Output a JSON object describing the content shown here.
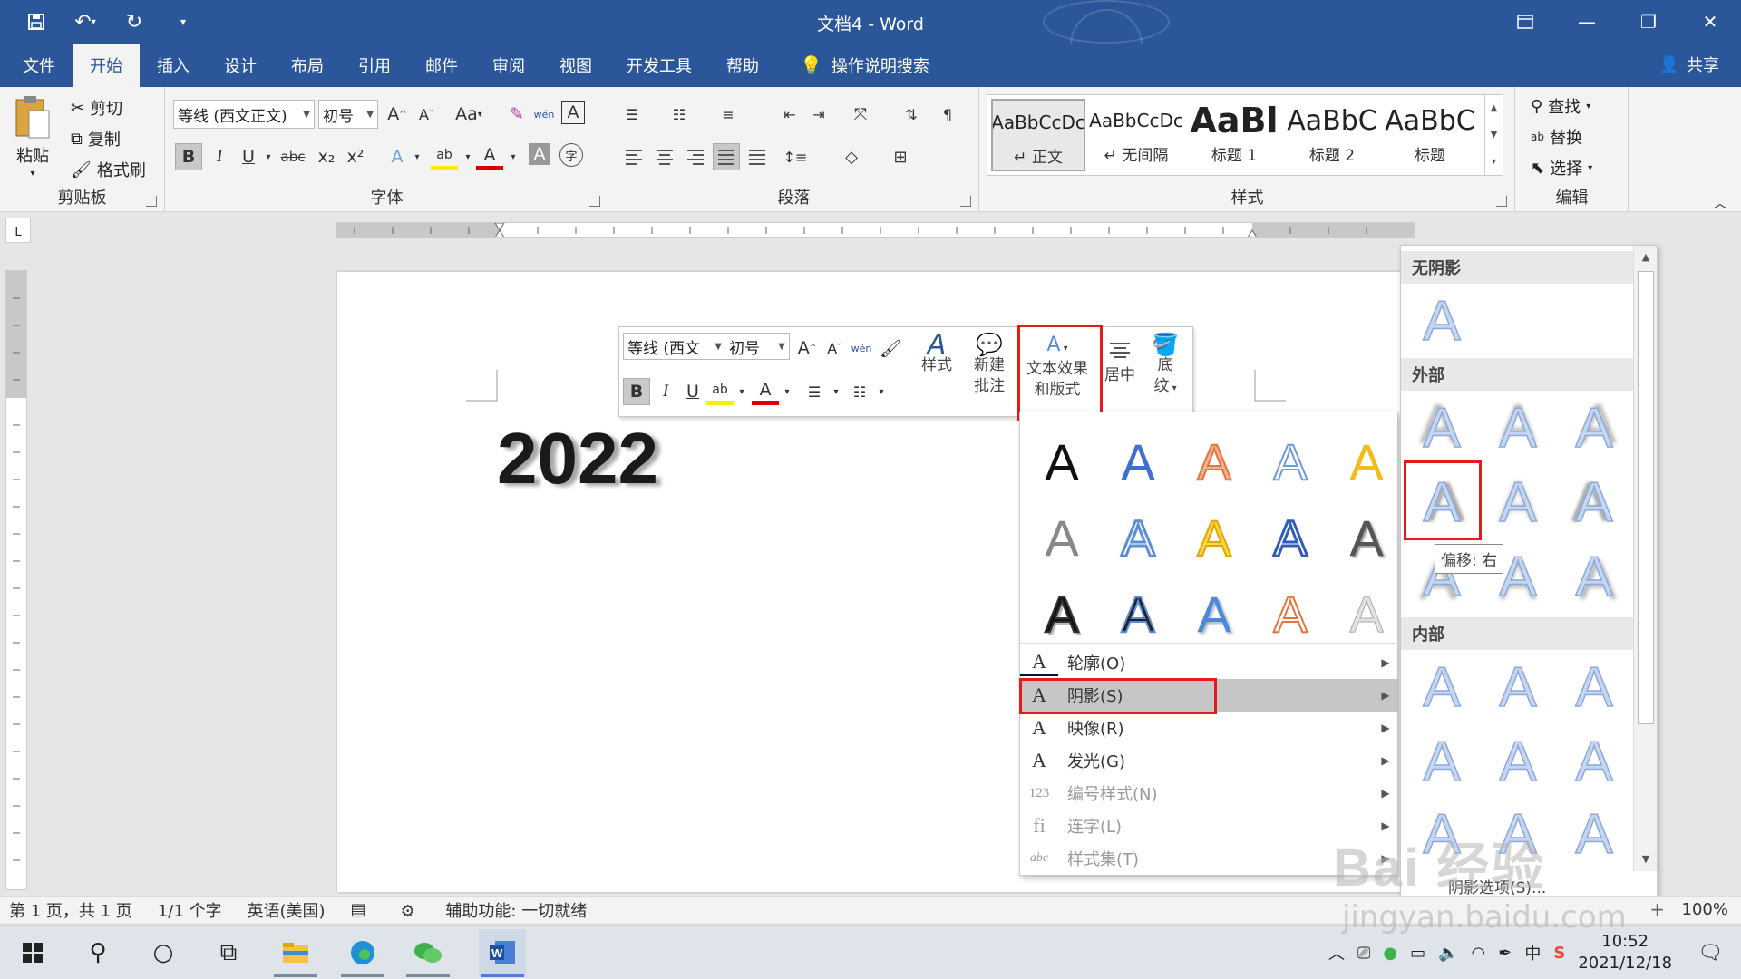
{
  "app": {
    "title": "文档4  -  Word",
    "share": "共享"
  },
  "tabs": [
    "文件",
    "开始",
    "插入",
    "设计",
    "布局",
    "引用",
    "邮件",
    "审阅",
    "视图",
    "开发工具",
    "帮助"
  ],
  "tab_search": "操作说明搜索",
  "clipboard": {
    "paste": "粘贴",
    "cut": "剪切",
    "copy": "复制",
    "format_painter": "格式刷",
    "label": "剪贴板"
  },
  "font": {
    "name": "等线 (西文正文)",
    "size": "初号",
    "label": "字体",
    "bold": "B",
    "italic": "I",
    "underline": "U",
    "strike": "abc",
    "sub": "x₂",
    "sup": "x²",
    "case": "Aa",
    "phonetic": "wén",
    "clear_label": "A"
  },
  "paragraph": {
    "label": "段落"
  },
  "styles": {
    "label": "样式",
    "items": [
      {
        "sample": "AaBbCcDc",
        "name": "↵ 正文"
      },
      {
        "sample": "AaBbCcDc",
        "name": "↵ 无间隔"
      },
      {
        "sample": "AaBl",
        "name": "标题 1"
      },
      {
        "sample": "AaBbC",
        "name": "标题 2"
      },
      {
        "sample": "AaBbC",
        "name": "标题"
      }
    ]
  },
  "editing": {
    "find": "查找",
    "replace": "替换",
    "select": "选择",
    "label": "编辑"
  },
  "document": {
    "text": "2022"
  },
  "mini_toolbar": {
    "font": "等线 (西文",
    "size": "初号",
    "styles": "样式",
    "new_comment_1": "新建",
    "new_comment_2": "批注",
    "text_effects_1": "文本效果",
    "text_effects_2": "和版式",
    "center": "居中",
    "shading_1": "底",
    "shading_2": "纹"
  },
  "effects_menu": {
    "grid_glyph": "A",
    "items": [
      {
        "icon": "A",
        "label": "轮廓(O)",
        "disabled": false
      },
      {
        "icon": "A",
        "label": "阴影(S)",
        "disabled": false
      },
      {
        "icon": "A",
        "label": "映像(R)",
        "disabled": false
      },
      {
        "icon": "A",
        "label": "发光(G)",
        "disabled": false
      },
      {
        "icon": "123",
        "label": "编号样式(N)",
        "disabled": true
      },
      {
        "icon": "fi",
        "label": "连字(L)",
        "disabled": true
      },
      {
        "icon": "abc",
        "label": "样式集(T)",
        "disabled": true
      }
    ]
  },
  "shadow_menu": {
    "no_shadow": "无阴影",
    "outer": "外部",
    "inner": "内部",
    "tooltip": "偏移: 右",
    "footer": "阴影选项(S)..."
  },
  "status": {
    "page": "第 1 页，共 1 页",
    "words": "1/1 个字",
    "language": "英语(美国)",
    "accessibility": "辅助功能: 一切就绪",
    "zoom": "100%"
  },
  "taskbar": {
    "time": "10:52",
    "date": "2021/12/18",
    "ime": "中"
  },
  "watermark": {
    "logo": "Bai 经验",
    "url": "jingyan.baidu.com"
  },
  "colors": {
    "brand": "#2b579a",
    "highlight": "#e81919",
    "ribbon": "#f3f3f3"
  }
}
